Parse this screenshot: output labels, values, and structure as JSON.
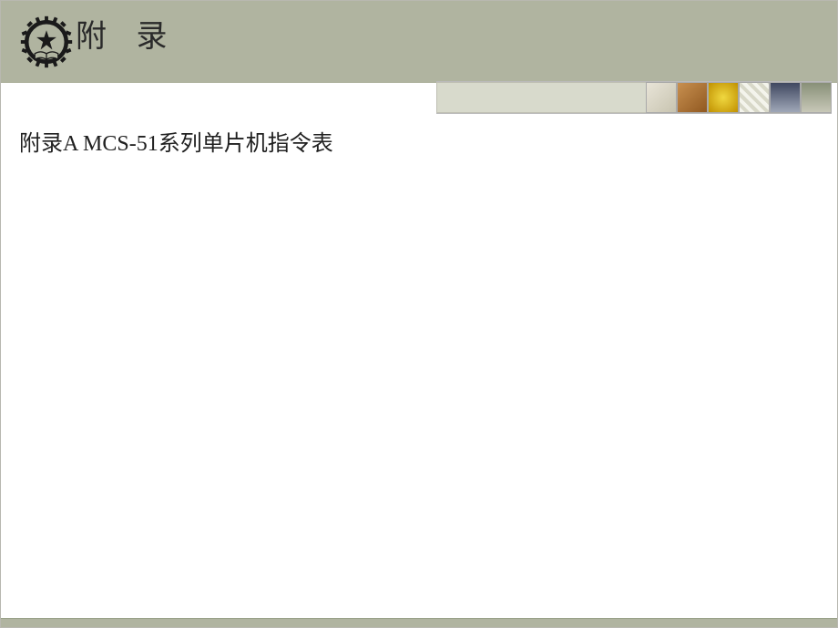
{
  "header": {
    "title": "附   录"
  },
  "content": {
    "subtitle": "附录A  MCS-51系列单片机指令表"
  },
  "thumbnails": {
    "names": [
      "thumb-clock-icon",
      "thumb-abstract-icon",
      "thumb-globe-icon",
      "thumb-grid-icon",
      "thumb-people-icon",
      "thumb-nature-icon"
    ]
  }
}
